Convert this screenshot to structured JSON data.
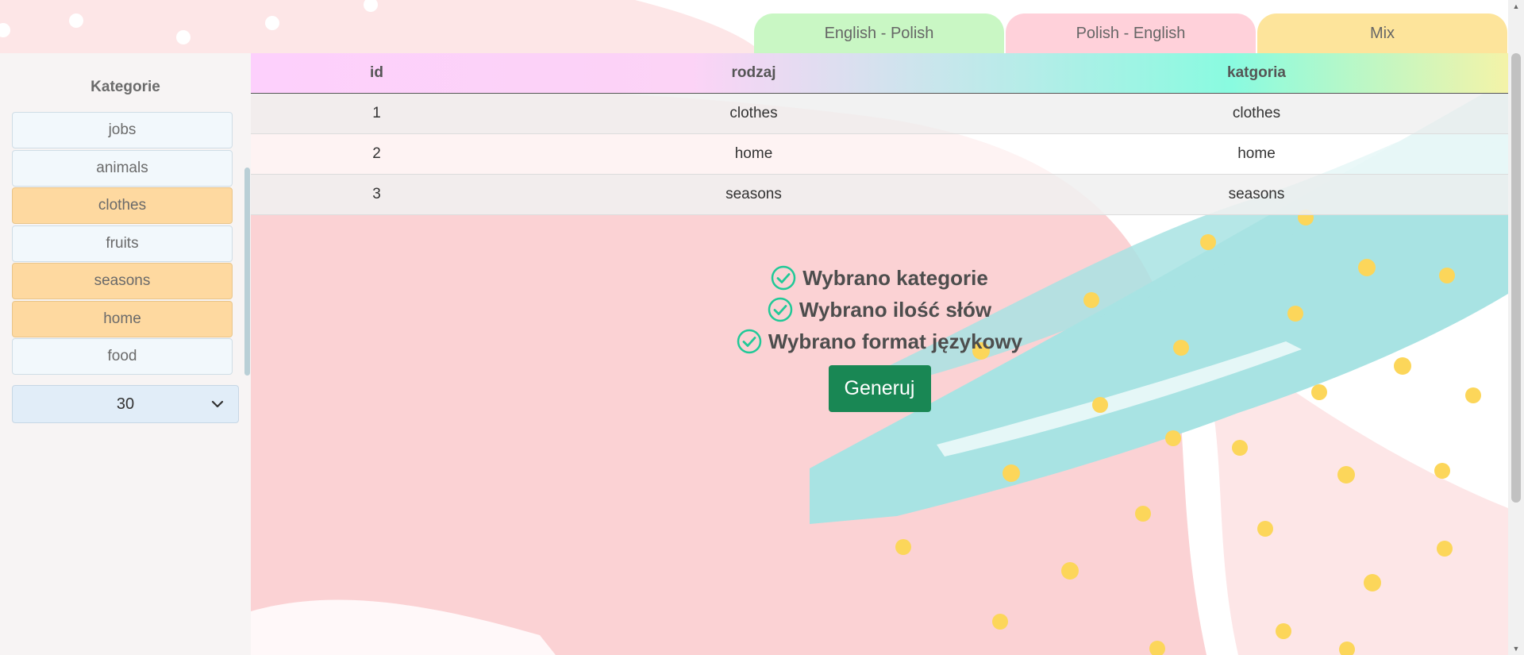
{
  "tabs": [
    {
      "label": "English - Polish"
    },
    {
      "label": "Polish - English"
    },
    {
      "label": "Mix"
    }
  ],
  "sidebar": {
    "title": "Kategorie",
    "categories": [
      {
        "label": "jobs",
        "selected": false
      },
      {
        "label": "animals",
        "selected": false
      },
      {
        "label": "clothes",
        "selected": true
      },
      {
        "label": "fruits",
        "selected": false
      },
      {
        "label": "seasons",
        "selected": true
      },
      {
        "label": "home",
        "selected": true
      },
      {
        "label": "food",
        "selected": false
      }
    ],
    "word_count": {
      "value": "30"
    }
  },
  "table": {
    "headers": [
      "id",
      "rodzaj",
      "katgoria"
    ],
    "rows": [
      [
        "1",
        "clothes",
        "clothes"
      ],
      [
        "2",
        "home",
        "home"
      ],
      [
        "3",
        "seasons",
        "seasons"
      ]
    ]
  },
  "status": {
    "lines": [
      "Wybrano kategorie",
      "Wybrano ilość słów",
      "Wybrano format językowy"
    ]
  },
  "generate_button": {
    "label": "Generuj"
  },
  "colors": {
    "accent": "#198754",
    "check": "#20c997",
    "selected_category": "#fed9a0",
    "tab_english_polish": "#c9f7c4",
    "tab_polish_english": "#ffd1da",
    "tab_mix": "#fde49b"
  },
  "icons": {
    "status": "check-circle-icon",
    "select": "chevron-down-icon"
  }
}
